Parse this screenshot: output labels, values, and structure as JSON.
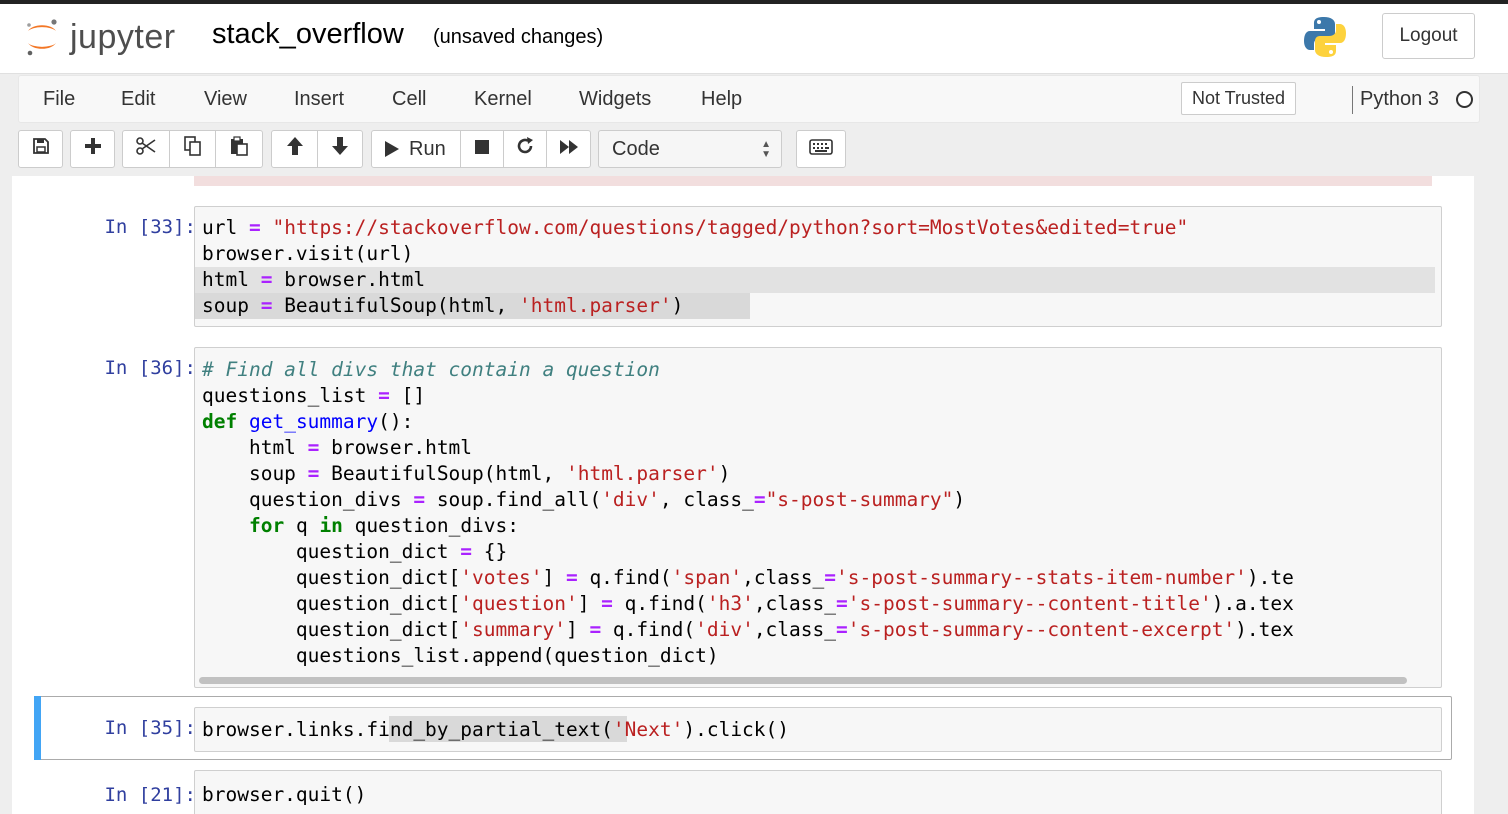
{
  "header": {
    "logo_text": "jupyter",
    "notebook_name": "stack_overflow",
    "save_status": "(unsaved changes)",
    "logout_label": "Logout"
  },
  "menu": {
    "items": [
      "File",
      "Edit",
      "View",
      "Insert",
      "Cell",
      "Kernel",
      "Widgets",
      "Help"
    ],
    "trust_label": "Not Trusted",
    "kernel_name": "Python 3"
  },
  "toolbar": {
    "run_label": "Run",
    "cell_type": "Code"
  },
  "cells": [
    {
      "prompt": "In [33]:",
      "lines": [
        "url = \"https://stackoverflow.com/questions/tagged/python?sort=MostVotes&edited=true\"",
        "browser.visit(url)",
        "html = browser.html",
        "soup = BeautifulSoup(html, 'html.parser')"
      ]
    },
    {
      "prompt": "In [36]:",
      "lines": [
        "# Find all divs that contain a question",
        "questions_list = []",
        "def get_summary():",
        "    html = browser.html",
        "    soup = BeautifulSoup(html, 'html.parser')",
        "    question_divs = soup.find_all('div', class_=\"s-post-summary\")",
        "    for q in question_divs:",
        "        question_dict = {}",
        "        question_dict['votes'] = q.find('span',class_='s-post-summary--stats-item-number').te",
        "        question_dict['question'] = q.find('h3',class_='s-post-summary--content-title').a.tex",
        "        question_dict['summary'] = q.find('div',class_='s-post-summary--content-excerpt').tex",
        "        questions_list.append(question_dict)"
      ]
    },
    {
      "prompt": "In [35]:",
      "lines": [
        "browser.links.find_by_partial_text('Next').click()"
      ]
    },
    {
      "prompt": "In [21]:",
      "lines": [
        "browser.quit()"
      ]
    }
  ],
  "colors": {
    "prompt": "#303f9f",
    "keyword": "#008000",
    "string": "#ba2121",
    "operator": "#aa22ff",
    "comment": "#408080",
    "function_name": "#0000ff",
    "selected_cell_bar": "#42a5f5"
  },
  "icons": [
    "jupyter-logo-icon",
    "python-logo-icon",
    "save-icon",
    "plus-icon",
    "scissors-icon",
    "copy-icon",
    "paste-icon",
    "arrow-up-icon",
    "arrow-down-icon",
    "play-icon",
    "stop-icon",
    "restart-icon",
    "fast-forward-icon",
    "keyboard-icon",
    "kernel-idle-icon"
  ]
}
